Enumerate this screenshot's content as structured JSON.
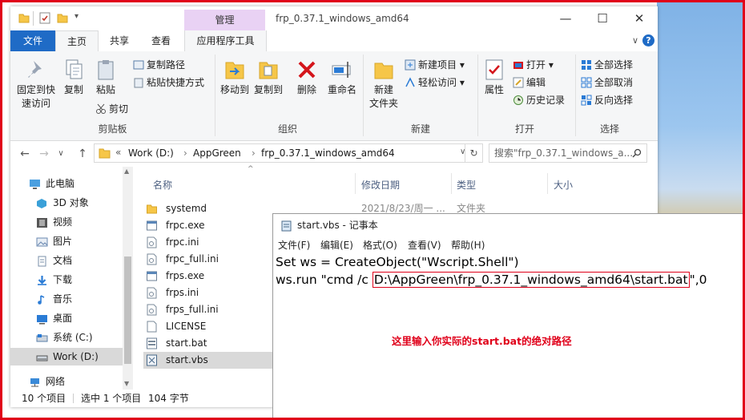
{
  "explorer": {
    "contextual_tab": "管理",
    "window_title": "frp_0.37.1_windows_amd64",
    "controls": {
      "minimize": "—",
      "maximize": "☐",
      "close": "✕"
    },
    "tabs": {
      "file": "文件",
      "home": "主页",
      "share": "共享",
      "view": "查看",
      "app_tools": "应用程序工具"
    },
    "ribbon": {
      "clipboard": {
        "pin_line1": "固定到快",
        "pin_line2": "速访问",
        "copy": "复制",
        "paste": "粘贴",
        "copy_path": "复制路径",
        "paste_shortcut": "粘贴快捷方式",
        "cut": "剪切",
        "label": "剪贴板"
      },
      "organize": {
        "move_to": "移动到",
        "copy_to": "复制到",
        "delete": "删除",
        "rename": "重命名",
        "label": "组织"
      },
      "new": {
        "new_folder_line1": "新建",
        "new_folder_line2": "文件夹",
        "new_item": "新建项目",
        "easy_access": "轻松访问",
        "label": "新建"
      },
      "open": {
        "properties": "属性",
        "open": "打开",
        "edit": "编辑",
        "history": "历史记录",
        "label": "打开"
      },
      "select": {
        "select_all": "全部选择",
        "select_none": "全部取消",
        "invert": "反向选择",
        "label": "选择"
      }
    },
    "nav": {
      "back": "←",
      "forward": "→",
      "dropdown": "∨",
      "up": "↑",
      "breadcrumb_prefix": "«",
      "breadcrumb": [
        "Work (D:)",
        "AppGreen",
        "frp_0.37.1_windows_amd64"
      ],
      "sep": "›",
      "search_placeholder": "搜索\"frp_0.37.1_windows_a...",
      "refresh": "↻"
    },
    "sidebar": [
      {
        "label": "此电脑",
        "icon": "computer-icon",
        "color": "#4a9fe0"
      },
      {
        "label": "3D 对象",
        "icon": "3d-objects-icon",
        "color": "#3aa0d8"
      },
      {
        "label": "视频",
        "icon": "video-icon",
        "color": "#555555"
      },
      {
        "label": "图片",
        "icon": "picture-icon",
        "color": "#6a88b0"
      },
      {
        "label": "文档",
        "icon": "document-icon",
        "color": "#7a8fa8"
      },
      {
        "label": "下载",
        "icon": "download-icon",
        "color": "#2a7bd5"
      },
      {
        "label": "音乐",
        "icon": "music-icon",
        "color": "#2a7bd5"
      },
      {
        "label": "桌面",
        "icon": "desktop-icon",
        "color": "#2a7bd5"
      },
      {
        "label": "系统 (C:)",
        "icon": "drive-c-icon",
        "color": "#5a7fa8"
      },
      {
        "label": "Work (D:)",
        "icon": "drive-d-icon",
        "color": "#555555"
      },
      {
        "label": "网络",
        "icon": "network-icon",
        "color": "#3a8ad8"
      }
    ],
    "columns": {
      "name": "名称",
      "date": "修改日期",
      "type": "类型",
      "size": "大小"
    },
    "files": [
      {
        "name": "systemd",
        "date": "2021/8/23/周一 ...",
        "type": "文件夹",
        "icon": "folder-icon"
      },
      {
        "name": "frpc.exe",
        "icon": "exe-icon"
      },
      {
        "name": "frpc.ini",
        "icon": "ini-file-icon"
      },
      {
        "name": "frpc_full.ini",
        "icon": "ini-file-icon"
      },
      {
        "name": "frps.exe",
        "icon": "exe-icon"
      },
      {
        "name": "frps.ini",
        "icon": "ini-file-icon"
      },
      {
        "name": "frps_full.ini",
        "icon": "ini-file-icon"
      },
      {
        "name": "LICENSE",
        "icon": "file-icon"
      },
      {
        "name": "start.bat",
        "icon": "bat-file-icon"
      },
      {
        "name": "start.vbs",
        "icon": "vbs-file-icon"
      }
    ],
    "status": {
      "count": "10 个项目",
      "selected": "选中 1 个项目",
      "size": "104 字节"
    }
  },
  "notepad": {
    "title": "start.vbs - 记事本",
    "menu": [
      "文件(F)",
      "编辑(E)",
      "格式(O)",
      "查看(V)",
      "帮助(H)"
    ],
    "line1": "Set ws = CreateObject(\"Wscript.Shell\")",
    "line2_pre": "ws.run \"cmd /c ",
    "line2_path": "D:\\AppGreen\\frp_0.37.1_windows_amd64\\start.bat",
    "line2_post": "\",0",
    "annotation": "这里输入你实际的start.bat的绝对路径"
  },
  "colors": {
    "accent": "#1f6bc6",
    "highlight": "#e0001a",
    "context_tab": "#e9d2f4",
    "selection": "#cce8ff"
  }
}
